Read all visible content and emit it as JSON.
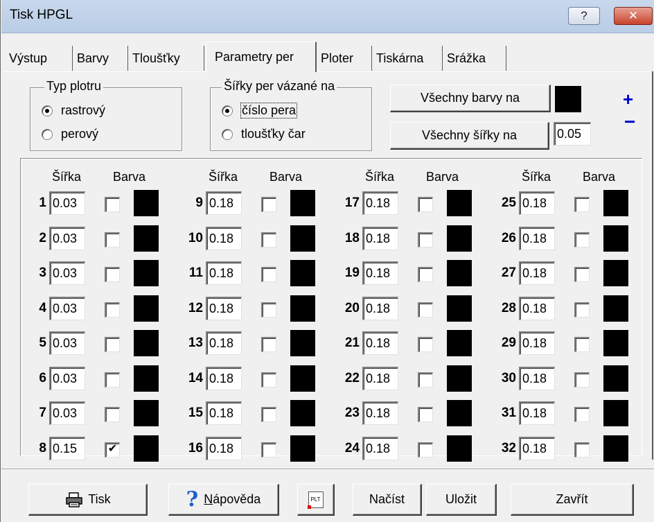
{
  "window": {
    "title": "Tisk HPGL",
    "help_label": "?",
    "close_label": "✕"
  },
  "tabs": [
    {
      "label": "Výstup"
    },
    {
      "label": "Barvy"
    },
    {
      "label": "Tloušťky"
    },
    {
      "label": "Parametry per",
      "active": true
    },
    {
      "label": "Ploter"
    },
    {
      "label": "Tiskárna"
    },
    {
      "label": "Srážka"
    }
  ],
  "plot_type": {
    "label": "Typ plotru",
    "options": [
      {
        "label": "rastrový",
        "checked": true
      },
      {
        "label": "perový",
        "checked": false
      }
    ]
  },
  "widths_bound": {
    "label": "Šířky per vázané na",
    "options": [
      {
        "label": "číslo pera",
        "checked": true
      },
      {
        "label": "tloušťky čar",
        "checked": false
      }
    ]
  },
  "all_colors": {
    "button_label": "Všechny barvy na",
    "swatch_color": "#000000"
  },
  "all_widths": {
    "button_label": "Všechny šířky na",
    "value": "0.05"
  },
  "zoom": {
    "plus": "+",
    "minus": "−"
  },
  "pen_table": {
    "width_header": "Šířka",
    "color_header": "Barva",
    "pens": [
      {
        "num": "1",
        "width": "0.03",
        "checked": false,
        "color": "#000000"
      },
      {
        "num": "2",
        "width": "0.03",
        "checked": false,
        "color": "#000000"
      },
      {
        "num": "3",
        "width": "0.03",
        "checked": false,
        "color": "#000000"
      },
      {
        "num": "4",
        "width": "0.03",
        "checked": false,
        "color": "#000000"
      },
      {
        "num": "5",
        "width": "0.03",
        "checked": false,
        "color": "#000000"
      },
      {
        "num": "6",
        "width": "0.03",
        "checked": false,
        "color": "#000000"
      },
      {
        "num": "7",
        "width": "0.03",
        "checked": false,
        "color": "#000000"
      },
      {
        "num": "8",
        "width": "0.15",
        "checked": true,
        "color": "#000000"
      },
      {
        "num": "9",
        "width": "0.18",
        "checked": false,
        "color": "#000000"
      },
      {
        "num": "10",
        "width": "0.18",
        "checked": false,
        "color": "#000000"
      },
      {
        "num": "11",
        "width": "0.18",
        "checked": false,
        "color": "#000000"
      },
      {
        "num": "12",
        "width": "0.18",
        "checked": false,
        "color": "#000000"
      },
      {
        "num": "13",
        "width": "0.18",
        "checked": false,
        "color": "#000000"
      },
      {
        "num": "14",
        "width": "0.18",
        "checked": false,
        "color": "#000000"
      },
      {
        "num": "15",
        "width": "0.18",
        "checked": false,
        "color": "#000000"
      },
      {
        "num": "16",
        "width": "0.18",
        "checked": false,
        "color": "#000000"
      },
      {
        "num": "17",
        "width": "0.18",
        "checked": false,
        "color": "#000000"
      },
      {
        "num": "18",
        "width": "0.18",
        "checked": false,
        "color": "#000000"
      },
      {
        "num": "19",
        "width": "0.18",
        "checked": false,
        "color": "#000000"
      },
      {
        "num": "20",
        "width": "0.18",
        "checked": false,
        "color": "#000000"
      },
      {
        "num": "21",
        "width": "0.18",
        "checked": false,
        "color": "#000000"
      },
      {
        "num": "22",
        "width": "0.18",
        "checked": false,
        "color": "#000000"
      },
      {
        "num": "23",
        "width": "0.18",
        "checked": false,
        "color": "#000000"
      },
      {
        "num": "24",
        "width": "0.18",
        "checked": false,
        "color": "#000000"
      },
      {
        "num": "25",
        "width": "0.18",
        "checked": false,
        "color": "#000000"
      },
      {
        "num": "26",
        "width": "0.18",
        "checked": false,
        "color": "#000000"
      },
      {
        "num": "27",
        "width": "0.18",
        "checked": false,
        "color": "#000000"
      },
      {
        "num": "28",
        "width": "0.18",
        "checked": false,
        "color": "#000000"
      },
      {
        "num": "29",
        "width": "0.18",
        "checked": false,
        "color": "#000000"
      },
      {
        "num": "30",
        "width": "0.18",
        "checked": false,
        "color": "#000000"
      },
      {
        "num": "31",
        "width": "0.18",
        "checked": false,
        "color": "#000000"
      },
      {
        "num": "32",
        "width": "0.18",
        "checked": false,
        "color": "#000000"
      }
    ]
  },
  "footer": {
    "print_label": "Tisk",
    "help_label_rest": "ápověda",
    "help_label_accel": "N",
    "plt_icon_text": "PLT",
    "load_label": "Načíst",
    "save_label": "Uložit",
    "close_label": "Zavřít"
  },
  "colors": {
    "accent_blue": "#0000cc",
    "close_red": "#c7432b",
    "help_icon_blue": "#1b5fc9"
  }
}
